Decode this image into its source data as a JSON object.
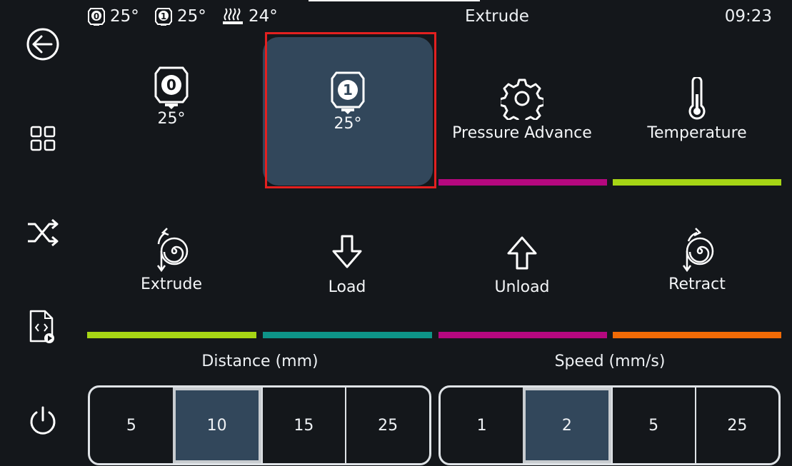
{
  "status": {
    "extruder0_temp": "25°",
    "extruder1_temp": "25°",
    "bed_temp": "24°",
    "title": "Extrude",
    "time": "09:23"
  },
  "sidebar": {
    "icons": [
      "back-icon",
      "grid-icon",
      "shuffle-icon",
      "file-code-icon",
      "power-icon"
    ]
  },
  "tools": [
    {
      "label": "0",
      "temp": "25°"
    },
    {
      "label": "1",
      "temp": "25°"
    }
  ],
  "settings": {
    "pressure_advance": "Pressure Advance",
    "temperature": "Temperature"
  },
  "actions": {
    "extrude": "Extrude",
    "load": "Load",
    "unload": "Unload",
    "retract": "Retract"
  },
  "distance": {
    "label": "Distance (mm)",
    "options": [
      "5",
      "10",
      "15",
      "25"
    ],
    "selected": "10"
  },
  "speed": {
    "label": "Speed (mm/s)",
    "options": [
      "1",
      "2",
      "5",
      "25"
    ],
    "selected": "2"
  },
  "colors": {
    "background": "#14171b",
    "active_tile": "#32475b",
    "lime": "#a6d515",
    "teal": "#0e9488",
    "magenta": "#b5087f",
    "orange": "#f06a06",
    "highlight": "#e32020"
  }
}
